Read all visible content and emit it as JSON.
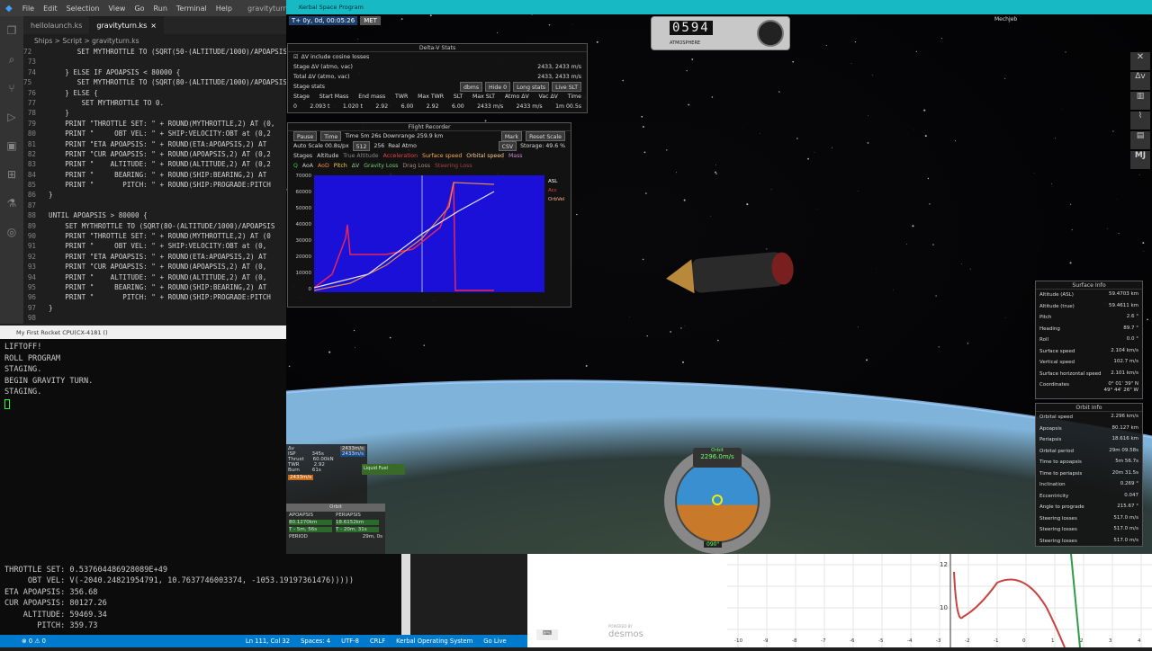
{
  "vscode": {
    "menu": [
      "File",
      "Edit",
      "Selection",
      "View",
      "Go",
      "Run",
      "Terminal",
      "Help"
    ],
    "title_right": "gravityturn.ks",
    "tabs": [
      {
        "label": "hellolaunch.ks"
      },
      {
        "label": "gravityturn.ks",
        "close": "×"
      }
    ],
    "breadcrumb": "Ships > Script > gravityturn.ks",
    "code": [
      {
        "n": "72",
        "t": "        SET MYTHROTTLE TO (SQRT(50-(ALTITUDE/1000)/APOAPSIS*"
      },
      {
        "n": "73",
        "t": ""
      },
      {
        "n": "74",
        "t": "    } ELSE IF APOAPSIS < 80000 {"
      },
      {
        "n": "75",
        "t": "        SET MYTHROTTLE TO (SQRT(80-(ALTITUDE/1000)/APOAPSIS*"
      },
      {
        "n": "76",
        "t": "    } ELSE {"
      },
      {
        "n": "77",
        "t": "        SET MYTHROTTLE TO 0."
      },
      {
        "n": "78",
        "t": "    }"
      },
      {
        "n": "79",
        "t": "    PRINT \"THROTTLE SET: \" + ROUND(MYTHROTTLE,2) AT (0,"
      },
      {
        "n": "80",
        "t": "    PRINT \"     OBT VEL: \" + SHIP:VELOCITY:OBT at (0,2"
      },
      {
        "n": "81",
        "t": "    PRINT \"ETA APOAPSIS: \" + ROUND(ETA:APOAPSIS,2) AT"
      },
      {
        "n": "82",
        "t": "    PRINT \"CUR APOAPSIS: \" + ROUND(APOAPSIS,2) AT (0,2"
      },
      {
        "n": "83",
        "t": "    PRINT \"    ALTITUDE: \" + ROUND(ALTITUDE,2) AT (0,2"
      },
      {
        "n": "84",
        "t": "    PRINT \"     BEARING: \" + ROUND(SHIP:BEARING,2) AT"
      },
      {
        "n": "85",
        "t": "    PRINT \"       PITCH: \" + ROUND(SHIP:PROGRADE:PITCH"
      },
      {
        "n": "86",
        "t": "}"
      },
      {
        "n": "87",
        "t": ""
      },
      {
        "n": "88",
        "t": "UNTIL APOAPSIS > 80000 {"
      },
      {
        "n": "89",
        "t": "    SET MYTHROTTLE TO (SQRT(80-(ALTITUDE/1000)/APOAPSIS"
      },
      {
        "n": "90",
        "t": "    PRINT \"THROTTLE SET: \" + ROUND(MYTHROTTLE,2) AT (0"
      },
      {
        "n": "91",
        "t": "    PRINT \"     OBT VEL: \" + SHIP:VELOCITY:OBT at (0,"
      },
      {
        "n": "92",
        "t": "    PRINT \"ETA APOAPSIS: \" + ROUND(ETA:APOAPSIS,2) AT"
      },
      {
        "n": "93",
        "t": "    PRINT \"CUR APOAPSIS: \" + ROUND(APOAPSIS,2) AT (0,"
      },
      {
        "n": "94",
        "t": "    PRINT \"    ALTITUDE: \" + ROUND(ALTITUDE,2) AT (0,"
      },
      {
        "n": "95",
        "t": "    PRINT \"     BEARING: \" + ROUND(SHIP:BEARING,2) AT"
      },
      {
        "n": "96",
        "t": "    PRINT \"       PITCH: \" + ROUND(SHIP:PROGRADE:PITCH"
      },
      {
        "n": "97",
        "t": "}"
      },
      {
        "n": "98",
        "t": ""
      }
    ],
    "status": {
      "errors": "⊗ 0 ⚠ 0",
      "position": "Ln 111, Col 32",
      "spaces": "Spaces: 4",
      "encoding": "UTF-8",
      "eol": "CRLF",
      "language": "Kerbal Operating System",
      "golive": "Go Live"
    }
  },
  "terminal": {
    "title": "My First Rocket CPU(CX-4181 ()",
    "lines1": [
      "LIFTOFF!",
      "ROLL PROGRAM",
      "STAGING.",
      "BEGIN GRAVITY TURN.",
      "STAGING."
    ],
    "lines2": [
      "THROTTLE SET: 0.537604486928089E+49",
      "     OBT VEL: V(-2040.24821954791, 10.7637746003374, -1053.19197361476)))))",
      "ETA APOAPSIS: 356.68",
      "CUR APOAPSIS: 80127.26",
      "    ALTITUDE: 59469.34",
      "       PITCH: 359.73"
    ]
  },
  "ksp": {
    "title": "Kerbal Space Program",
    "met": "T+ 0y, 0d, 00:05:26",
    "met_label": "MET",
    "altimeter": "0594",
    "atmosphere_label": "ATMOSPHERE",
    "mechjeb": "MechJeb",
    "toolbar_icons": [
      "wrench-icon",
      "deltav-icon",
      "crew-icon",
      "graph-icon",
      "camera-icon",
      "mj-icon"
    ],
    "mj": "MJ",
    "deltav": {
      "title": "Delta-V Stats",
      "checkbox": "ΔV include cosine losses",
      "stage_dv_label": "Stage ΔV (atmo, vac)",
      "stage_dv_value": "2433, 2433 m/s",
      "total_dv_label": "Total ΔV (atmo, vac)",
      "total_dv_value": "2433, 2433 m/s",
      "stage_stats": "Stage stats",
      "buttons": [
        "dbms",
        "Hide 0",
        "Long stats",
        "Live SLT"
      ],
      "headers": [
        "Stage",
        "Start Mass",
        "End mass",
        "TWR",
        "Max TWR",
        "SLT",
        "Max SLT",
        "Atmo ΔV",
        "Vac ΔV",
        "Time"
      ],
      "row": [
        "0",
        "2.093 t",
        "1.020 t",
        "2.92",
        "6.00",
        "2.92",
        "6.00",
        "2433 m/s",
        "2433 m/s",
        "1m 00.5s"
      ]
    },
    "recorder": {
      "title": "Flight Recorder",
      "pause": "Pause",
      "time": "Time",
      "time_text": "Time 5m 26s Downrange 259.9 km",
      "mark": "Mark",
      "reset": "Reset Scale",
      "autoscale": "Auto Scale 00.8s/px",
      "scale": "512",
      "x": "256",
      "realatmo": "Real Atmo",
      "csv": "CSV",
      "storage": "Storage: 49.6 %",
      "checks1": [
        "Stages",
        "Altitude",
        "True Altitude",
        "Acceleration",
        "Surface speed",
        "Orbital speed",
        "Mass"
      ],
      "checks2": [
        "Q",
        "AoA",
        "AoD",
        "Pitch",
        "ΔV",
        "Gravity Loss",
        "Drag Loss",
        "Steering Loss"
      ],
      "ticks": [
        "70000",
        "60000",
        "50000",
        "40000",
        "30000",
        "20000",
        "10000",
        "0"
      ],
      "legend": [
        "ASL",
        "Acc",
        "OrbVel"
      ]
    },
    "stage_panel": {
      "dv_label": "Δv",
      "dv": "2433m/s",
      "isp_label": "ISP",
      "isp": "345s",
      "isp2": "2433m/s",
      "thrust_label": "Thrust",
      "thrust": "60.00kN",
      "twr_label": "TWR",
      "twr": "2.92",
      "burn_label": "Burn",
      "burn": "61s",
      "total": "2433m/s",
      "fuel": "Liquid Fuel"
    },
    "orbit_panel": {
      "title": "Orbit",
      "apo_label": "APOAPSIS",
      "apo": "80.1270km",
      "apo_t": "T - 5m, 56s",
      "peri_label": "PERIAPSIS",
      "peri": "18.6152km",
      "peri_t": "T - 20m, 31s",
      "period_label": "PERIOD",
      "period": "29m, 0s"
    },
    "navball": {
      "mode": "Orbit",
      "speed": "2296.0m/s",
      "heading": "090°",
      "hdg_label": "HDG"
    },
    "surface": {
      "title": "Surface Info",
      "rows": [
        [
          "Altitude (ASL)",
          "59.4703 km"
        ],
        [
          "Altitude (true)",
          "59.4611 km"
        ],
        [
          "Pitch",
          "2.6 °"
        ],
        [
          "Heading",
          "89.7 °"
        ],
        [
          "Roll",
          "0.0 °"
        ],
        [
          "Surface speed",
          "2.104 km/s"
        ],
        [
          "Vertical speed",
          "102.7 m/s"
        ],
        [
          "Surface horizontal speed",
          "2.101 km/s"
        ],
        [
          "Coordinates",
          "0° 01' 39\" N\n49° 44' 26\" W"
        ]
      ]
    },
    "orbitinfo": {
      "title": "Orbit Info",
      "rows": [
        [
          "Orbital speed",
          "2.296 km/s"
        ],
        [
          "Apoapsis",
          "80.127 km"
        ],
        [
          "Periapsis",
          "18.616 km"
        ],
        [
          "Orbital period",
          "29m 09.58s"
        ],
        [
          "Time to apoapsis",
          "5m 56.7s"
        ],
        [
          "Time to periapsis",
          "20m 31.5s"
        ],
        [
          "Inclination",
          "0.269 °"
        ],
        [
          "Eccentricity",
          "0.047"
        ],
        [
          "Angle to prograde",
          "215.67 °"
        ],
        [
          "Steering losses",
          "517.0 m/s"
        ],
        [
          "Steering losses",
          "517.0 m/s"
        ],
        [
          "Steering losses",
          "517.0 m/s"
        ]
      ]
    }
  },
  "desmos": {
    "brand_small": "POWERED BY",
    "brand": "desmos",
    "y_ticks": [
      "12",
      "10"
    ],
    "x_ticks": [
      "-10",
      "-9",
      "-8",
      "-7",
      "-6",
      "-5",
      "-4",
      "-3",
      "-2",
      "-1",
      "0",
      "1",
      "2",
      "3",
      "4"
    ]
  }
}
